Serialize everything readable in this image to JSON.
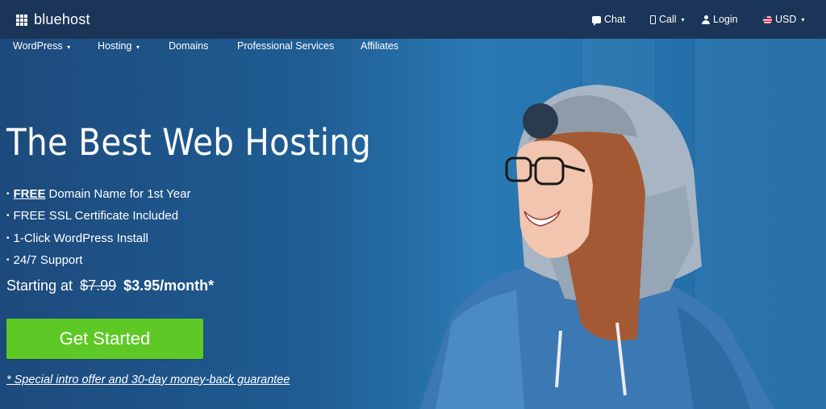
{
  "brand": {
    "name": "bluehost"
  },
  "utility_nav": {
    "chat": "Chat",
    "call": "Call",
    "login": "Login",
    "currency": "USD"
  },
  "main_nav": {
    "wordpress": "WordPress",
    "hosting": "Hosting",
    "domains": "Domains",
    "professional_services": "Professional Services",
    "affiliates": "Affiliates"
  },
  "hero": {
    "title": "The Best Web Hosting",
    "features": [
      {
        "strong": "FREE",
        "text": "Domain Name for 1st Year"
      },
      {
        "text": "FREE SSL Certificate Included"
      },
      {
        "text": "1-Click WordPress Install"
      },
      {
        "text": "24/7 Support"
      }
    ],
    "pricing_prefix": "Starting at",
    "old_price": "$7.99",
    "new_price": "$3.95/month*",
    "cta_label": "Get Started",
    "offer_note": "* Special intro offer and 30-day money-back guarantee"
  },
  "icons": {
    "logo": "grid-logo-icon",
    "chat": "chat-bubble-icon",
    "call": "phone-icon",
    "login": "user-icon",
    "currency": "us-flag-icon",
    "dropdown": "caret-down-icon"
  },
  "colors": {
    "topbar": "#1a3557",
    "hero_blue": "#1f5f96",
    "cta_green": "#5ec926"
  }
}
